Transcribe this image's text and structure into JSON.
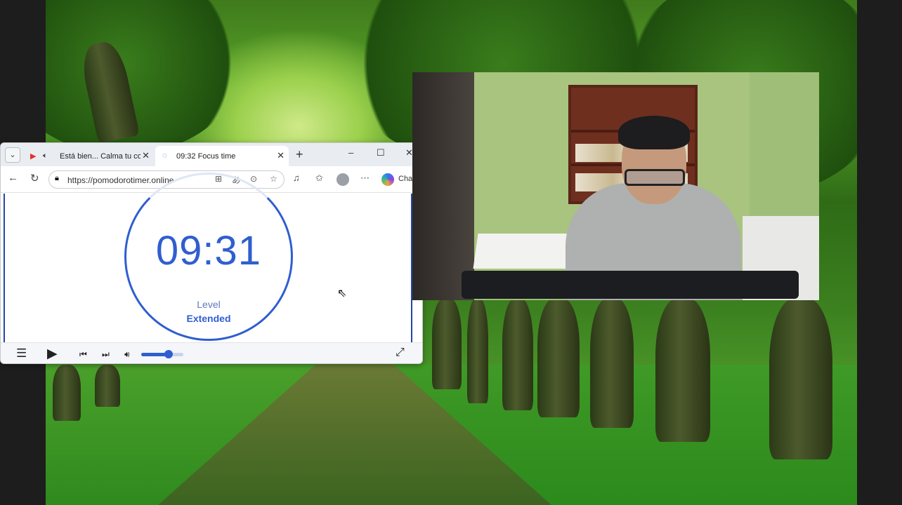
{
  "browser": {
    "tabs": [
      {
        "label": "Está bien... Calma tu cora",
        "icon": "youtube-icon"
      },
      {
        "label": "09:32 Focus time",
        "icon": "loading-icon"
      }
    ],
    "window_controls": {
      "minimize": "–",
      "maximize": "☐",
      "close": "✕"
    },
    "url": "https://pomodorotimer.online",
    "copilot_label": "Chat"
  },
  "timer": {
    "display": "09:31",
    "level_label": "Level",
    "level_value": "Extended"
  },
  "player": {
    "volume_fraction": 0.65
  },
  "colors": {
    "accent": "#2f5ed0",
    "tab_bar": "#e9edf2",
    "forest": "#3b7f1f"
  }
}
